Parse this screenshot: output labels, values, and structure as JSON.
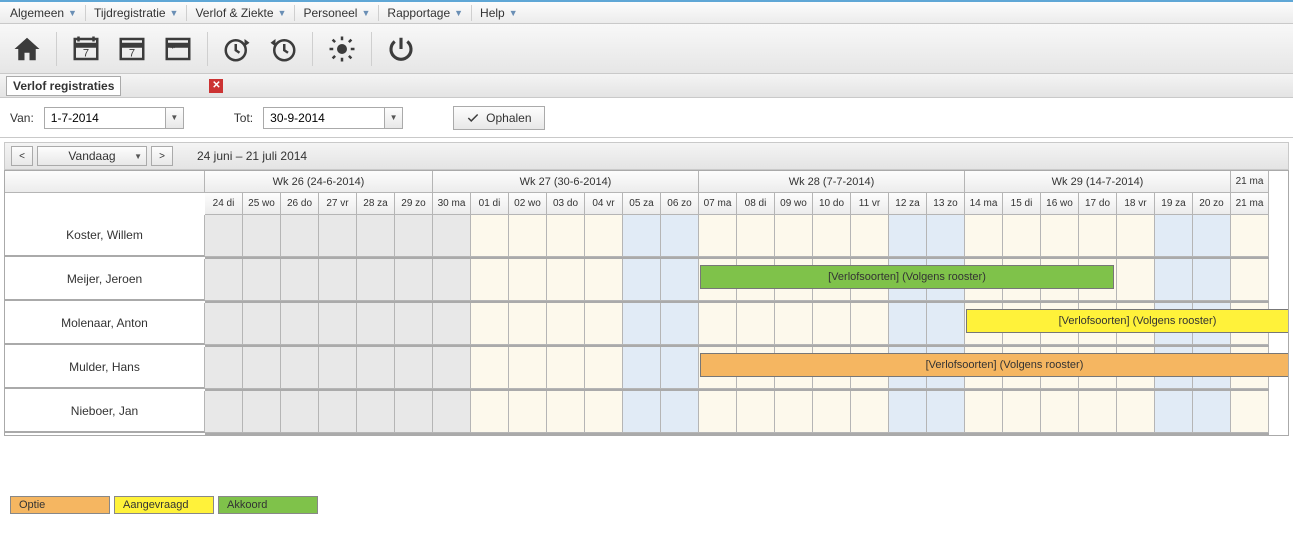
{
  "menu": {
    "items": [
      "Algemeen",
      "Tijdregistratie",
      "Verlof & Ziekte",
      "Personeel",
      "Rapportage",
      "Help"
    ]
  },
  "panel": {
    "title": "Verlof registraties"
  },
  "filters": {
    "from_label": "Van:",
    "from_value": "1-7-2014",
    "to_label": "Tot:",
    "to_value": "30-9-2014",
    "fetch_label": "Ophalen"
  },
  "nav": {
    "today_label": "Vandaag",
    "range_label": "24 juni – 21 juli 2014"
  },
  "weeks": [
    {
      "label": "Wk 26 (24-6-2014)",
      "span": 6
    },
    {
      "label": "Wk 27 (30-6-2014)",
      "span": 7
    },
    {
      "label": "Wk 28 (7-7-2014)",
      "span": 7
    },
    {
      "label": "Wk 29 (14-7-2014)",
      "span": 7
    },
    {
      "label": "",
      "span": 1
    }
  ],
  "days": [
    {
      "l": "24 di",
      "bg": "gray"
    },
    {
      "l": "25 wo",
      "bg": "gray"
    },
    {
      "l": "26 do",
      "bg": "gray"
    },
    {
      "l": "27 vr",
      "bg": "gray"
    },
    {
      "l": "28 za",
      "bg": "gray"
    },
    {
      "l": "29 zo",
      "bg": "gray"
    },
    {
      "l": "30 ma",
      "bg": "gray"
    },
    {
      "l": "01 di",
      "bg": "cream"
    },
    {
      "l": "02 wo",
      "bg": "cream"
    },
    {
      "l": "03 do",
      "bg": "cream"
    },
    {
      "l": "04 vr",
      "bg": "cream"
    },
    {
      "l": "05 za",
      "bg": "blue"
    },
    {
      "l": "06 zo",
      "bg": "blue"
    },
    {
      "l": "07 ma",
      "bg": "cream"
    },
    {
      "l": "08 di",
      "bg": "cream"
    },
    {
      "l": "09 wo",
      "bg": "cream"
    },
    {
      "l": "10 do",
      "bg": "cream"
    },
    {
      "l": "11 vr",
      "bg": "cream"
    },
    {
      "l": "12 za",
      "bg": "blue"
    },
    {
      "l": "13 zo",
      "bg": "blue"
    },
    {
      "l": "14 ma",
      "bg": "cream"
    },
    {
      "l": "15 di",
      "bg": "cream"
    },
    {
      "l": "16 wo",
      "bg": "cream"
    },
    {
      "l": "17 do",
      "bg": "cream"
    },
    {
      "l": "18 vr",
      "bg": "cream"
    },
    {
      "l": "19 za",
      "bg": "blue"
    },
    {
      "l": "20 zo",
      "bg": "blue"
    },
    {
      "l": "21 ma",
      "bg": "cream"
    }
  ],
  "partial_week_label": "21 ma",
  "employees": [
    {
      "name": "Koster, Willem",
      "bars": []
    },
    {
      "name": "Meijer, Jeroen",
      "bars": [
        {
          "start": 13,
          "end": 24,
          "color": "green",
          "label": "[Verlofsoorten] (Volgens rooster)",
          "overflow": false
        }
      ]
    },
    {
      "name": "Molenaar, Anton",
      "bars": [
        {
          "start": 20,
          "end": 28,
          "color": "yellow",
          "label": "[Verlofsoorten] (Volgens rooster)",
          "overflow": true
        }
      ]
    },
    {
      "name": "Mulder, Hans",
      "bars": [
        {
          "start": 13,
          "end": 28,
          "color": "orange",
          "label": "[Verlofsoorten] (Volgens rooster)",
          "overflow": true
        }
      ]
    },
    {
      "name": "Nieboer, Jan",
      "bars": []
    }
  ],
  "legend": {
    "optie": "Optie",
    "aangevraagd": "Aangevraagd",
    "akkoord": "Akkoord"
  }
}
